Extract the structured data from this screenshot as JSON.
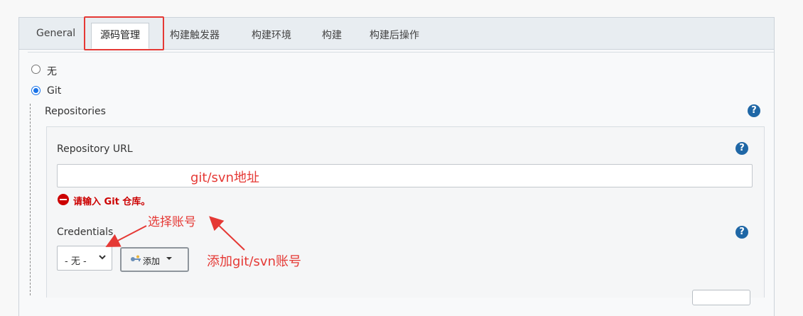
{
  "tabs": [
    "General",
    "源码管理",
    "构建触发器",
    "构建环境",
    "构建",
    "构建后操作"
  ],
  "active_tab": "源码管理",
  "scm": {
    "option_none": "无",
    "option_git": "Git",
    "selected": "Git"
  },
  "repositories": {
    "section_label": "Repositories",
    "url_label": "Repository URL",
    "url_value": "",
    "error": "请输入 Git 仓库。",
    "credentials_label": "Credentials",
    "credentials_selected": "- 无 -",
    "add_label": "添加"
  },
  "help_glyph": "?",
  "annotations": {
    "url_note": "git/svn地址",
    "select_note": "选择账号",
    "add_note": "添加git/svn账号",
    "color": "#e53935"
  },
  "icons": [
    "help-icon",
    "error-icon",
    "chevron-down-icon",
    "key-icon",
    "caret-down-icon"
  ]
}
